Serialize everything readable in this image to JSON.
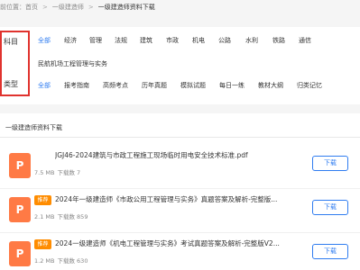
{
  "breadcrumb": {
    "location": "前位置：首页",
    "level1": "一级建造师",
    "current": "一级建造师资料下载"
  },
  "filters": {
    "subject_label": "科目",
    "subject_options": [
      "全部",
      "经济",
      "管理",
      "法规",
      "建筑",
      "市政",
      "机电",
      "公路",
      "水利",
      "铁路",
      "通信",
      "民航机场工程管理与实务"
    ],
    "type_label": "类型",
    "type_options": [
      "全部",
      "报考指南",
      "高频考点",
      "历年真题",
      "模拟试题",
      "每日一练",
      "教材大纲",
      "归类记忆"
    ]
  },
  "section": {
    "title": "一级建造师资料下载"
  },
  "files": [
    {
      "name": "JGJ46-2024建筑与市政工程施工现场临时用电安全技术标准.pdf",
      "size": "7.5 MB",
      "downloads": "下载数 7",
      "badge": "",
      "icon": "P",
      "button": "下载"
    },
    {
      "name": "2024年一级建造师《市政公用工程管理与实务》真题答案及解析-完整版...",
      "size": "2.1 MB",
      "downloads": "下载数 859",
      "badge": "推荐",
      "icon": "P",
      "button": "下载"
    },
    {
      "name": "2024一级建造师《机电工程管理与实务》考试真题答案及解析-完整版V2...",
      "size": "1.2 MB",
      "downloads": "下载数 630",
      "badge": "推荐",
      "icon": "P",
      "button": "下载"
    }
  ],
  "colors": {
    "accent": "#2f7cf0",
    "highlight_box": "#e0332e",
    "file_icon": "#ff7a45",
    "badge": "#ff8c00"
  }
}
